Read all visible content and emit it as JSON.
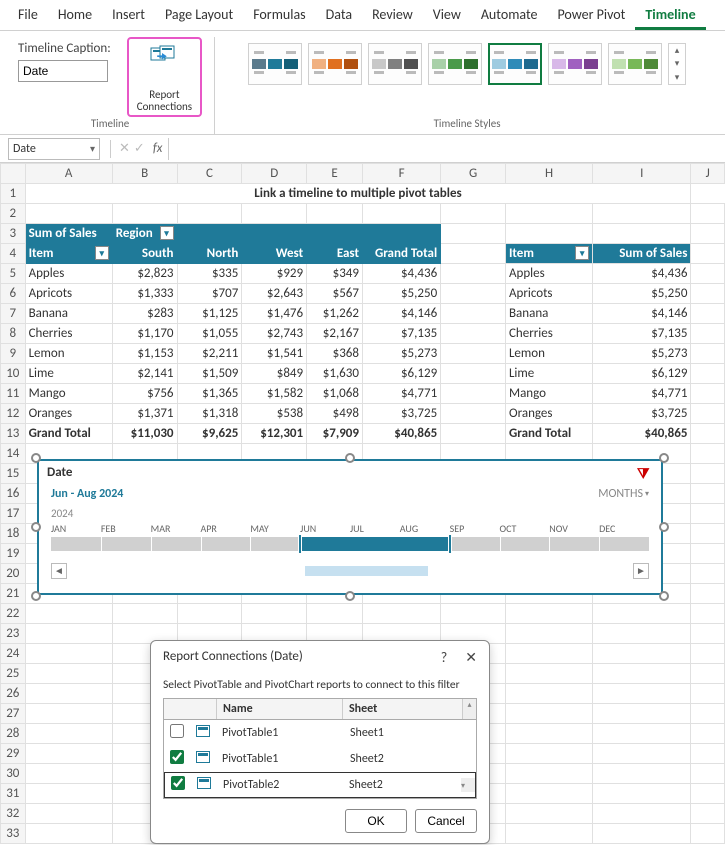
{
  "ribbon": {
    "tabs": [
      "File",
      "Home",
      "Insert",
      "Page Layout",
      "Formulas",
      "Data",
      "Review",
      "View",
      "Automate",
      "Power Pivot",
      "Timeline"
    ],
    "active_tab": "Timeline",
    "caption_label": "Timeline Caption:",
    "caption_value": "Date",
    "report_conn": {
      "l1": "Report",
      "l2": "Connections"
    },
    "group_timeline": "Timeline",
    "group_styles": "Timeline Styles",
    "style_colors": [
      [
        "#5a7a8c",
        "#1f7a99",
        "#145f78"
      ],
      [
        "#f0b080",
        "#e07020",
        "#b05010"
      ],
      [
        "#c8c8c8",
        "#808080",
        "#505050"
      ],
      [
        "#a8d0a8",
        "#4a9a4a",
        "#2e702e"
      ],
      [
        "#9ecbe0",
        "#2f8bb8",
        "#1f6a8f"
      ],
      [
        "#d8b8e8",
        "#a060c0",
        "#7a4090"
      ],
      [
        "#c0e0b0",
        "#78b858",
        "#4f8a38"
      ]
    ]
  },
  "fxbar": {
    "name_box": "Date"
  },
  "columns": [
    "A",
    "B",
    "C",
    "D",
    "E",
    "F",
    "G",
    "H",
    "I",
    "J"
  ],
  "page_title": "Link a timeline to multiple pivot tables",
  "pivot1": {
    "corner": "Sum of Sales",
    "col_field": "Region",
    "row_field": "Item",
    "cols": [
      "South",
      "North",
      "West",
      "East",
      "Grand Total"
    ],
    "rows": [
      {
        "item": "Apples",
        "v": [
          "$2,823",
          "$335",
          "$929",
          "$349",
          "$4,436"
        ]
      },
      {
        "item": "Apricots",
        "v": [
          "$1,333",
          "$707",
          "$2,643",
          "$567",
          "$5,250"
        ]
      },
      {
        "item": "Banana",
        "v": [
          "$283",
          "$1,125",
          "$1,476",
          "$1,262",
          "$4,146"
        ]
      },
      {
        "item": "Cherries",
        "v": [
          "$1,170",
          "$1,055",
          "$2,743",
          "$2,167",
          "$7,135"
        ]
      },
      {
        "item": "Lemon",
        "v": [
          "$1,153",
          "$2,211",
          "$1,541",
          "$368",
          "$5,273"
        ]
      },
      {
        "item": "Lime",
        "v": [
          "$2,141",
          "$1,509",
          "$849",
          "$1,630",
          "$6,129"
        ]
      },
      {
        "item": "Mango",
        "v": [
          "$756",
          "$1,365",
          "$1,582",
          "$1,068",
          "$4,771"
        ]
      },
      {
        "item": "Oranges",
        "v": [
          "$1,371",
          "$1,318",
          "$538",
          "$498",
          "$3,725"
        ]
      }
    ],
    "gt_label": "Grand Total",
    "gt": [
      "$11,030",
      "$9,625",
      "$12,301",
      "$7,909",
      "$40,865"
    ]
  },
  "pivot2": {
    "h1": "Item",
    "h2": "Sum of Sales",
    "rows": [
      {
        "item": "Apples",
        "val": "$4,436"
      },
      {
        "item": "Apricots",
        "val": "$5,250"
      },
      {
        "item": "Banana",
        "val": "$4,146"
      },
      {
        "item": "Cherries",
        "val": "$7,135"
      },
      {
        "item": "Lemon",
        "val": "$5,273"
      },
      {
        "item": "Lime",
        "val": "$6,129"
      },
      {
        "item": "Mango",
        "val": "$4,771"
      },
      {
        "item": "Oranges",
        "val": "$3,725"
      }
    ],
    "gt_label": "Grand Total",
    "gt": "$40,865"
  },
  "timeline": {
    "title": "Date",
    "period": "Jun - Aug 2024",
    "level": "MONTHS",
    "year": "2024",
    "months": [
      "JAN",
      "FEB",
      "MAR",
      "APR",
      "MAY",
      "JUN",
      "JUL",
      "AUG",
      "SEP",
      "OCT",
      "NOV",
      "DEC"
    ],
    "sel_start": 5,
    "sel_end": 8
  },
  "dialog": {
    "title": "Report Connections (Date)",
    "instr": "Select PivotTable and PivotChart reports to connect to this filter",
    "name_hdr": "Name",
    "sheet_hdr": "Sheet",
    "rows": [
      {
        "checked": false,
        "name": "PivotTable1",
        "sheet": "Sheet1",
        "outlined": false
      },
      {
        "checked": true,
        "name": "PivotTable1",
        "sheet": "Sheet2",
        "outlined": false
      },
      {
        "checked": true,
        "name": "PivotTable2",
        "sheet": "Sheet2",
        "outlined": true
      }
    ],
    "ok": "OK",
    "cancel": "Cancel"
  }
}
